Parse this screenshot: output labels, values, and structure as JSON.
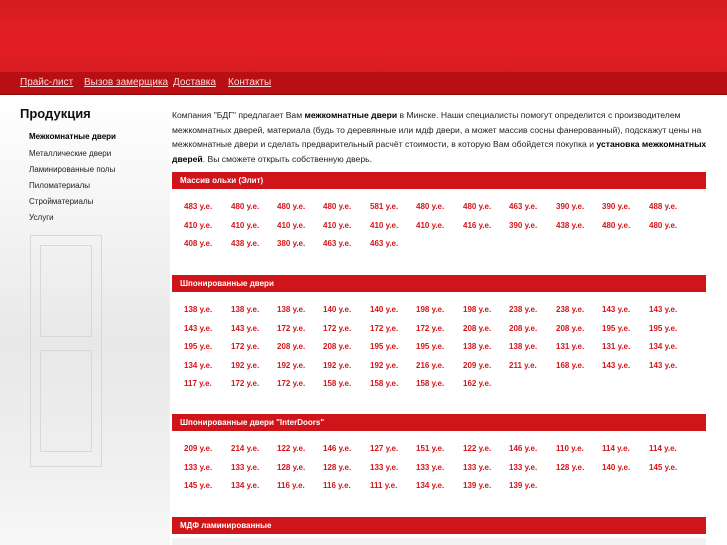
{
  "nav": [
    "Прайс-лист",
    "Вызов замерщика",
    "Доставка",
    "Контакты"
  ],
  "sidebar": {
    "title": "Продукция",
    "items": [
      "Межкомнатные двери",
      "Металлические двери",
      "Ламинированные полы",
      "Пиломатериалы",
      "Стройматериалы",
      "Услуги"
    ],
    "active_index": 0
  },
  "intro": {
    "p1": "Компания \"БДГ\" предлагает Вам ",
    "b1": "межкомнатные двери",
    "p2": " в Минске. Наши специалисты помогут определится с производителем межкомнатных дверей, материала (будь то деревянные или мдф двери, а может массив сосны фанерованный), подскажут цены на межкомнатные двери и сделать предварительный расчёт стоимости, в которую Вам обойдется покупка и ",
    "b2": "установка межкомнатных дверей",
    "p3": ". Вы сможете открыть собственную дверь."
  },
  "sections": [
    {
      "title": "Массив ольхи (Элит)",
      "prices": [
        "483 у.е.",
        "480 у.е.",
        "480 у.е.",
        "480 у.е.",
        "581 у.е.",
        "480 у.е.",
        "480 у.е.",
        "463 у.е.",
        "390 у.е.",
        "390 у.е.",
        "488 у.е.",
        "410 у.е.",
        "410 у.е.",
        "410 у.е.",
        "410 у.е.",
        "410 у.е.",
        "410 у.е.",
        "416 у.е.",
        "390 у.е.",
        "438 у.е.",
        "480 у.е.",
        "480 у.е.",
        "408 у.е.",
        "438 у.е.",
        "380 у.е.",
        "463 у.е.",
        "463 у.е."
      ]
    },
    {
      "title": "Шпонированные двери",
      "prices": [
        "138 у.е.",
        "138 у.е.",
        "138 у.е.",
        "140 у.е.",
        "140 у.е.",
        "198 у.е.",
        "198 у.е.",
        "238 у.е.",
        "238 у.е.",
        "143 у.е.",
        "143 у.е.",
        "143 у.е.",
        "143 у.е.",
        "172 у.е.",
        "172 у.е.",
        "172 у.е.",
        "172 у.е.",
        "208 у.е.",
        "208 у.е.",
        "208 у.е.",
        "195 у.е.",
        "195 у.е.",
        "195 у.е.",
        "172 у.е.",
        "208 у.е.",
        "208 у.е.",
        "195 у.е.",
        "195 у.е.",
        "138 у.е.",
        "138 у.е.",
        "131 у.е.",
        "131 у.е.",
        "134 у.е.",
        "134 у.е.",
        "192 у.е.",
        "192 у.е.",
        "192 у.е.",
        "192 у.е.",
        "216 у.е.",
        "209 у.е.",
        "211 у.е.",
        "168 у.е.",
        "143 у.е.",
        "143 у.е.",
        "117 у.е.",
        "172 у.е.",
        "172 у.е.",
        "158 у.е.",
        "158 у.е.",
        "158 у.е.",
        "162 у.е."
      ]
    },
    {
      "title": "Шпонированные двери \"InterDoors\"",
      "prices": [
        "209 у.е.",
        "214 у.е.",
        "122 у.е.",
        "146 у.е.",
        "127 у.е.",
        "151 у.е.",
        "122 у.е.",
        "146 у.е.",
        "110 у.е.",
        "114 у.е.",
        "114 у.е.",
        "133 у.е.",
        "133 у.е.",
        "128 у.е.",
        "128 у.е.",
        "133 у.е.",
        "133 у.е.",
        "133 у.е.",
        "133 у.е.",
        "128 у.е.",
        "140 у.е.",
        "145 у.е.",
        "145 у.е.",
        "134 у.е.",
        "116 у.е.",
        "116 у.е.",
        "111 у.е.",
        "134 у.е.",
        "139 у.е.",
        "139 у.е."
      ]
    },
    {
      "title": "МДФ ламинированные",
      "prices": []
    }
  ]
}
